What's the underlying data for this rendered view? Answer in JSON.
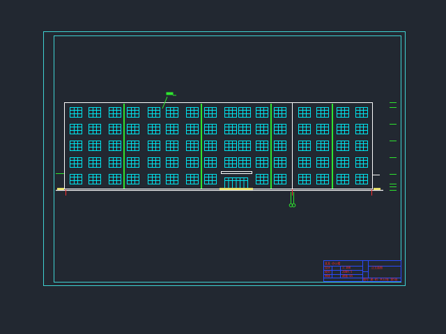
{
  "drawing": {
    "background": "#222831",
    "frame_color": "#3fd4d4",
    "wall_color": "#ffffff",
    "window_color": "#00e6f0",
    "pilaster_color": "#2ee62e",
    "dim_color": "#ff3030",
    "ground_color": "#ffffff",
    "grade_hatch_color": "#e6e06a",
    "facade": {
      "floors": 5,
      "bays_left_block": 11,
      "bays_right_block": 4,
      "entrance_floor": 1
    }
  },
  "title_block": {
    "border_color": "#2b4bff",
    "text_color": "#ff2e2e",
    "project_name": "某某·办公楼",
    "drawing_name": "正立面图",
    "fields": [
      {
        "key": "designer",
        "value": "设计"
      },
      {
        "key": "checker",
        "value": "校对"
      },
      {
        "key": "approver",
        "value": "审核"
      },
      {
        "key": "scale",
        "value": "1:100"
      },
      {
        "key": "date",
        "value": "2009.5"
      },
      {
        "key": "sheet",
        "value": "建施-05"
      }
    ],
    "footer": "图号 建-05 共12张 第5张"
  }
}
